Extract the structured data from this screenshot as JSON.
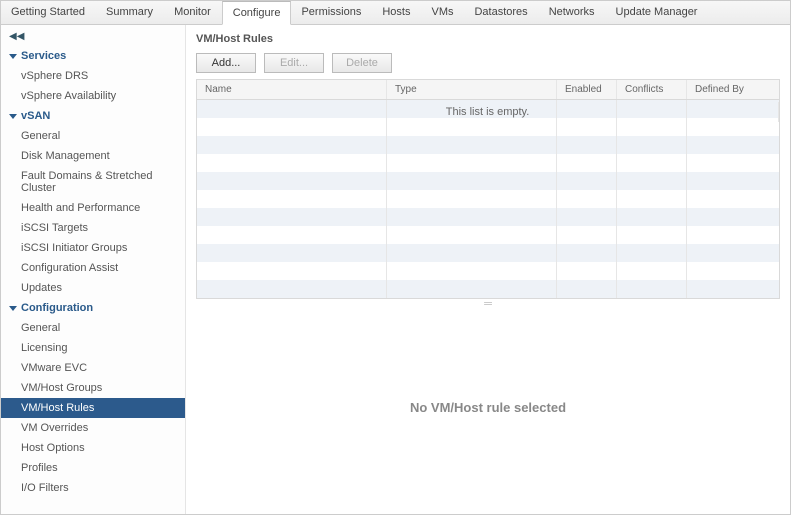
{
  "tabs": [
    "Getting Started",
    "Summary",
    "Monitor",
    "Configure",
    "Permissions",
    "Hosts",
    "VMs",
    "Datastores",
    "Networks",
    "Update Manager"
  ],
  "active_tab": "Configure",
  "collapse_glyph": "◀◀",
  "sidebar": {
    "groups": [
      {
        "label": "Services",
        "items": [
          "vSphere DRS",
          "vSphere Availability"
        ]
      },
      {
        "label": "vSAN",
        "items": [
          "General",
          "Disk Management",
          "Fault Domains & Stretched Cluster",
          "Health and Performance",
          "iSCSI Targets",
          "iSCSI Initiator Groups",
          "Configuration Assist",
          "Updates"
        ]
      },
      {
        "label": "Configuration",
        "items": [
          "General",
          "Licensing",
          "VMware EVC",
          "VM/Host Groups",
          "VM/Host Rules",
          "VM Overrides",
          "Host Options",
          "Profiles",
          "I/O Filters"
        ]
      }
    ],
    "active_item": "VM/Host Rules"
  },
  "page": {
    "title": "VM/Host Rules",
    "toolbar": {
      "add": "Add...",
      "edit": "Edit...",
      "delete": "Delete"
    },
    "columns": {
      "name": "Name",
      "type": "Type",
      "enabled": "Enabled",
      "conflicts": "Conflicts",
      "defined": "Defined By"
    },
    "empty": "This list is empty.",
    "resizer": "═",
    "detail_empty": "No VM/Host rule selected"
  }
}
